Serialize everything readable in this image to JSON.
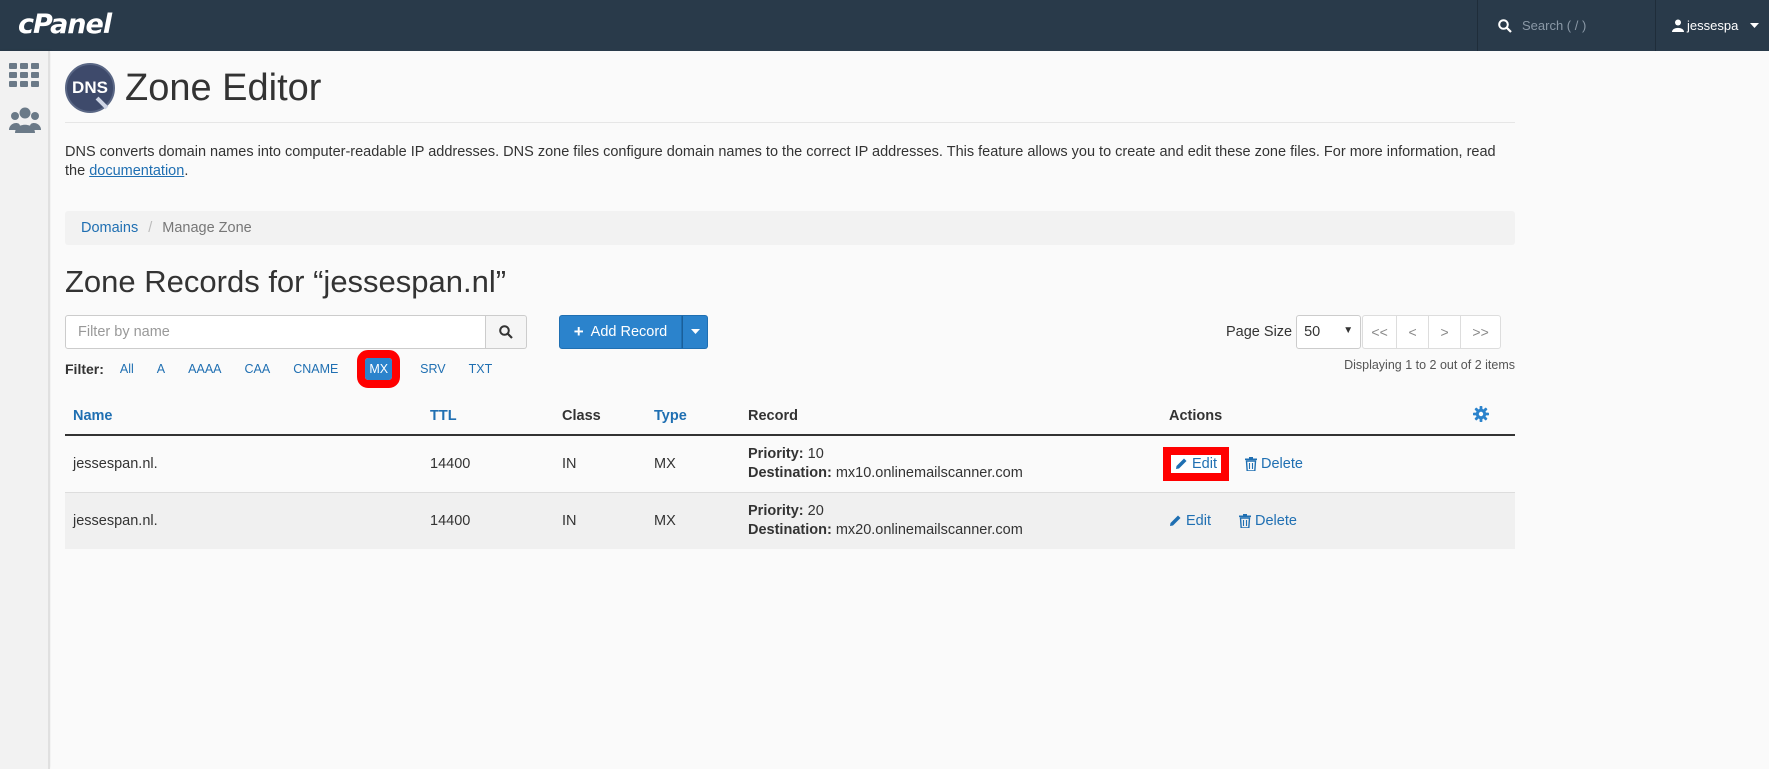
{
  "topbar": {
    "logo": "cPanel",
    "search_placeholder": "Search ( / )",
    "username": "jessespa"
  },
  "header": {
    "badge": "DNS",
    "title": "Zone Editor"
  },
  "description": {
    "text": "DNS converts domain names into computer-readable IP addresses. DNS zone files configure domain names to the correct IP addresses. This feature allows you to create and edit these zone files. For more information, read the ",
    "link": "documentation",
    "end": "."
  },
  "breadcrumb": {
    "items": [
      "Domains",
      "Manage Zone"
    ]
  },
  "zone_title": "Zone Records for “jessespan.nl”",
  "filter_input": {
    "placeholder": "Filter by name"
  },
  "add_record": {
    "label": "Add Record"
  },
  "pager": {
    "page_size_label": "Page Size",
    "page_size_value": "50",
    "buttons": [
      "<<",
      "<",
      ">",
      ">>"
    ],
    "displaying": "Displaying 1 to 2 out of 2 items"
  },
  "filters": {
    "label": "Filter:",
    "options": [
      "All",
      "A",
      "AAAA",
      "CAA",
      "CNAME",
      "MX",
      "SRV",
      "TXT"
    ],
    "active": "MX"
  },
  "table": {
    "headers": [
      "Name",
      "TTL",
      "Class",
      "Type",
      "Record",
      "Actions"
    ],
    "rows": [
      {
        "name": "jessespan.nl.",
        "ttl": "14400",
        "class": "IN",
        "type": "MX",
        "priority_label": "Priority:",
        "priority": "10",
        "destination_label": "Destination:",
        "destination": "mx10.onlinemailscanner.com",
        "edit": "Edit",
        "delete": "Delete"
      },
      {
        "name": "jessespan.nl.",
        "ttl": "14400",
        "class": "IN",
        "type": "MX",
        "priority_label": "Priority:",
        "priority": "20",
        "destination_label": "Destination:",
        "destination": "mx20.onlinemailscanner.com",
        "edit": "Edit",
        "delete": "Delete"
      }
    ]
  },
  "colors": {
    "topbar": "#293a4a",
    "accent": "#2b83cc",
    "link": "#1f6fb2",
    "highlight": "#ff0000"
  }
}
